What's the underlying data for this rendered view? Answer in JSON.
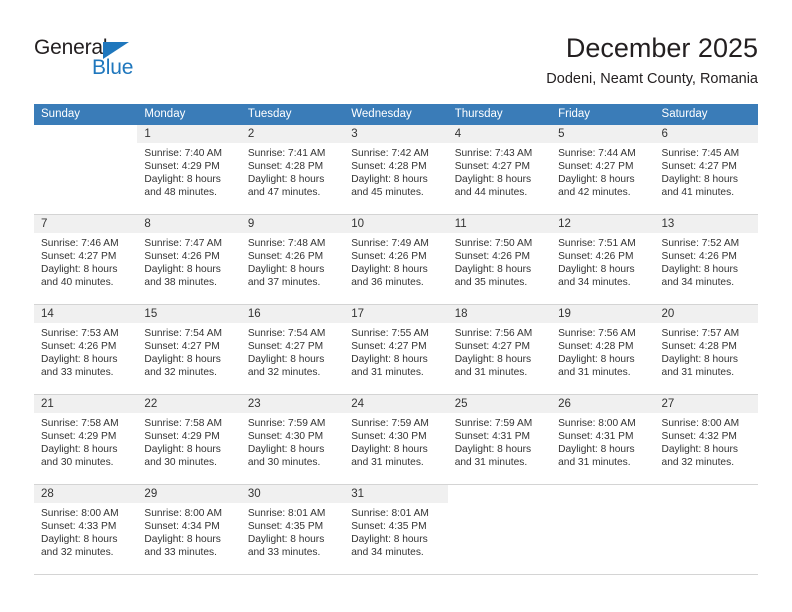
{
  "brand": {
    "name_part1": "General",
    "name_part2": "Blue",
    "accent_color": "#1f77bd",
    "triangle_icon": "triangle-icon"
  },
  "header": {
    "title": "December 2025",
    "subtitle": "Dodeni, Neamt County, Romania"
  },
  "calendar": {
    "header_bg": "#3a7cb8",
    "weekdays": [
      "Sunday",
      "Monday",
      "Tuesday",
      "Wednesday",
      "Thursday",
      "Friday",
      "Saturday"
    ],
    "weeks": [
      [
        {
          "empty": true
        },
        {
          "date": "1",
          "sunrise": "Sunrise: 7:40 AM",
          "sunset": "Sunset: 4:29 PM",
          "daylight_line1": "Daylight: 8 hours",
          "daylight_line2": "and 48 minutes."
        },
        {
          "date": "2",
          "sunrise": "Sunrise: 7:41 AM",
          "sunset": "Sunset: 4:28 PM",
          "daylight_line1": "Daylight: 8 hours",
          "daylight_line2": "and 47 minutes."
        },
        {
          "date": "3",
          "sunrise": "Sunrise: 7:42 AM",
          "sunset": "Sunset: 4:28 PM",
          "daylight_line1": "Daylight: 8 hours",
          "daylight_line2": "and 45 minutes."
        },
        {
          "date": "4",
          "sunrise": "Sunrise: 7:43 AM",
          "sunset": "Sunset: 4:27 PM",
          "daylight_line1": "Daylight: 8 hours",
          "daylight_line2": "and 44 minutes."
        },
        {
          "date": "5",
          "sunrise": "Sunrise: 7:44 AM",
          "sunset": "Sunset: 4:27 PM",
          "daylight_line1": "Daylight: 8 hours",
          "daylight_line2": "and 42 minutes."
        },
        {
          "date": "6",
          "sunrise": "Sunrise: 7:45 AM",
          "sunset": "Sunset: 4:27 PM",
          "daylight_line1": "Daylight: 8 hours",
          "daylight_line2": "and 41 minutes."
        }
      ],
      [
        {
          "date": "7",
          "sunrise": "Sunrise: 7:46 AM",
          "sunset": "Sunset: 4:27 PM",
          "daylight_line1": "Daylight: 8 hours",
          "daylight_line2": "and 40 minutes."
        },
        {
          "date": "8",
          "sunrise": "Sunrise: 7:47 AM",
          "sunset": "Sunset: 4:26 PM",
          "daylight_line1": "Daylight: 8 hours",
          "daylight_line2": "and 38 minutes."
        },
        {
          "date": "9",
          "sunrise": "Sunrise: 7:48 AM",
          "sunset": "Sunset: 4:26 PM",
          "daylight_line1": "Daylight: 8 hours",
          "daylight_line2": "and 37 minutes."
        },
        {
          "date": "10",
          "sunrise": "Sunrise: 7:49 AM",
          "sunset": "Sunset: 4:26 PM",
          "daylight_line1": "Daylight: 8 hours",
          "daylight_line2": "and 36 minutes."
        },
        {
          "date": "11",
          "sunrise": "Sunrise: 7:50 AM",
          "sunset": "Sunset: 4:26 PM",
          "daylight_line1": "Daylight: 8 hours",
          "daylight_line2": "and 35 minutes."
        },
        {
          "date": "12",
          "sunrise": "Sunrise: 7:51 AM",
          "sunset": "Sunset: 4:26 PM",
          "daylight_line1": "Daylight: 8 hours",
          "daylight_line2": "and 34 minutes."
        },
        {
          "date": "13",
          "sunrise": "Sunrise: 7:52 AM",
          "sunset": "Sunset: 4:26 PM",
          "daylight_line1": "Daylight: 8 hours",
          "daylight_line2": "and 34 minutes."
        }
      ],
      [
        {
          "date": "14",
          "sunrise": "Sunrise: 7:53 AM",
          "sunset": "Sunset: 4:26 PM",
          "daylight_line1": "Daylight: 8 hours",
          "daylight_line2": "and 33 minutes."
        },
        {
          "date": "15",
          "sunrise": "Sunrise: 7:54 AM",
          "sunset": "Sunset: 4:27 PM",
          "daylight_line1": "Daylight: 8 hours",
          "daylight_line2": "and 32 minutes."
        },
        {
          "date": "16",
          "sunrise": "Sunrise: 7:54 AM",
          "sunset": "Sunset: 4:27 PM",
          "daylight_line1": "Daylight: 8 hours",
          "daylight_line2": "and 32 minutes."
        },
        {
          "date": "17",
          "sunrise": "Sunrise: 7:55 AM",
          "sunset": "Sunset: 4:27 PM",
          "daylight_line1": "Daylight: 8 hours",
          "daylight_line2": "and 31 minutes."
        },
        {
          "date": "18",
          "sunrise": "Sunrise: 7:56 AM",
          "sunset": "Sunset: 4:27 PM",
          "daylight_line1": "Daylight: 8 hours",
          "daylight_line2": "and 31 minutes."
        },
        {
          "date": "19",
          "sunrise": "Sunrise: 7:56 AM",
          "sunset": "Sunset: 4:28 PM",
          "daylight_line1": "Daylight: 8 hours",
          "daylight_line2": "and 31 minutes."
        },
        {
          "date": "20",
          "sunrise": "Sunrise: 7:57 AM",
          "sunset": "Sunset: 4:28 PM",
          "daylight_line1": "Daylight: 8 hours",
          "daylight_line2": "and 31 minutes."
        }
      ],
      [
        {
          "date": "21",
          "sunrise": "Sunrise: 7:58 AM",
          "sunset": "Sunset: 4:29 PM",
          "daylight_line1": "Daylight: 8 hours",
          "daylight_line2": "and 30 minutes."
        },
        {
          "date": "22",
          "sunrise": "Sunrise: 7:58 AM",
          "sunset": "Sunset: 4:29 PM",
          "daylight_line1": "Daylight: 8 hours",
          "daylight_line2": "and 30 minutes."
        },
        {
          "date": "23",
          "sunrise": "Sunrise: 7:59 AM",
          "sunset": "Sunset: 4:30 PM",
          "daylight_line1": "Daylight: 8 hours",
          "daylight_line2": "and 30 minutes."
        },
        {
          "date": "24",
          "sunrise": "Sunrise: 7:59 AM",
          "sunset": "Sunset: 4:30 PM",
          "daylight_line1": "Daylight: 8 hours",
          "daylight_line2": "and 31 minutes."
        },
        {
          "date": "25",
          "sunrise": "Sunrise: 7:59 AM",
          "sunset": "Sunset: 4:31 PM",
          "daylight_line1": "Daylight: 8 hours",
          "daylight_line2": "and 31 minutes."
        },
        {
          "date": "26",
          "sunrise": "Sunrise: 8:00 AM",
          "sunset": "Sunset: 4:31 PM",
          "daylight_line1": "Daylight: 8 hours",
          "daylight_line2": "and 31 minutes."
        },
        {
          "date": "27",
          "sunrise": "Sunrise: 8:00 AM",
          "sunset": "Sunset: 4:32 PM",
          "daylight_line1": "Daylight: 8 hours",
          "daylight_line2": "and 32 minutes."
        }
      ],
      [
        {
          "date": "28",
          "sunrise": "Sunrise: 8:00 AM",
          "sunset": "Sunset: 4:33 PM",
          "daylight_line1": "Daylight: 8 hours",
          "daylight_line2": "and 32 minutes."
        },
        {
          "date": "29",
          "sunrise": "Sunrise: 8:00 AM",
          "sunset": "Sunset: 4:34 PM",
          "daylight_line1": "Daylight: 8 hours",
          "daylight_line2": "and 33 minutes."
        },
        {
          "date": "30",
          "sunrise": "Sunrise: 8:01 AM",
          "sunset": "Sunset: 4:35 PM",
          "daylight_line1": "Daylight: 8 hours",
          "daylight_line2": "and 33 minutes."
        },
        {
          "date": "31",
          "sunrise": "Sunrise: 8:01 AM",
          "sunset": "Sunset: 4:35 PM",
          "daylight_line1": "Daylight: 8 hours",
          "daylight_line2": "and 34 minutes."
        },
        {
          "empty": true
        },
        {
          "empty": true
        },
        {
          "empty": true
        }
      ]
    ]
  }
}
